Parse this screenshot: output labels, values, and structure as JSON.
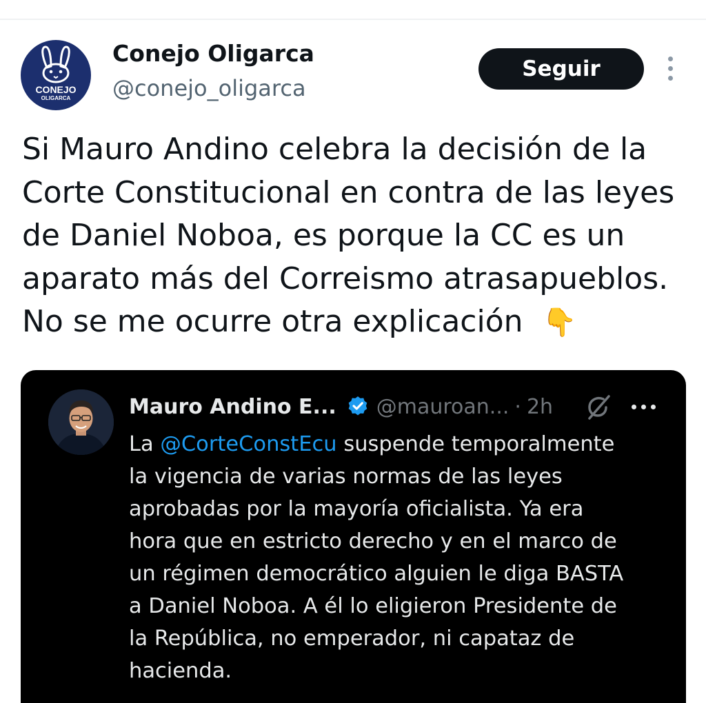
{
  "author": {
    "display_name": "Conejo Oligarca",
    "handle": "@conejo_oligarca",
    "avatar_logo_line1": "CONEJO",
    "avatar_logo_line2": "OLIGARCA"
  },
  "follow_button_label": "Seguir",
  "tweet": {
    "lines": [
      "Si Mauro Andino celebra la decisión de la",
      "Corte Constitucional en contra de las leyes",
      "de Daniel Noboa, es porque la CC es un",
      "aparato más del Correismo atrasapueblos.",
      "No se me ocurre otra explicación"
    ],
    "emoji": "👇"
  },
  "quoted": {
    "display_name": "Mauro Andino E...",
    "handle": "@mauroan...",
    "separator": "·",
    "time": "2h",
    "text_prefix": "La ",
    "mention": "@CorteConstEcu",
    "text_line1_rest": " suspende temporalmente",
    "lines": [
      "la vigencia de varias normas de las leyes",
      "aprobadas por la mayoría oficialista. Ya era",
      "hora que en estricto derecho y en el marco de",
      "un régimen democrático alguien le diga BASTA",
      "a Daniel Noboa. A él lo eligieron Presidente de",
      "la República, no emperador, ni capataz de",
      "hacienda."
    ]
  },
  "colors": {
    "text_primary": "#0f1419",
    "text_secondary": "#536471",
    "follow_bg": "#0f1419",
    "quote_bg": "#000000",
    "mention": "#1d9bf0",
    "verified": "#1d9bf0",
    "avatar_bg": "#1c2f6e"
  },
  "icons": [
    "rabbit-logo-icon",
    "more-vertical-icon",
    "pointing-down-emoji",
    "verified-badge-icon",
    "grok-icon",
    "more-horizontal-icon"
  ]
}
